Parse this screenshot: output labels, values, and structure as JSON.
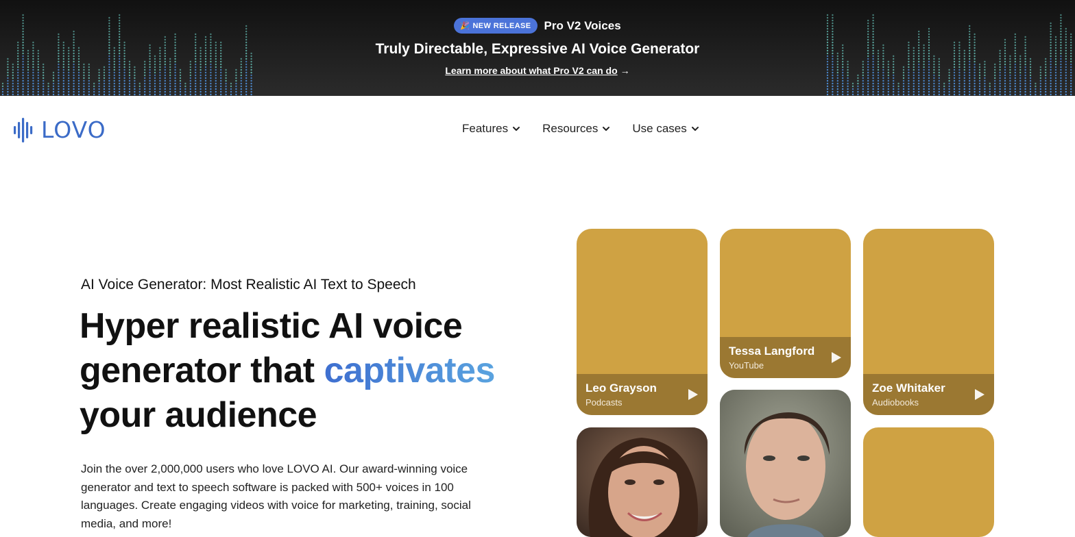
{
  "banner": {
    "badge_label": "NEW RELEASE",
    "badge_icon": "party-popper-icon",
    "product": "Pro V2 Voices",
    "headline": "Truly Directable, Expressive AI Voice Generator",
    "link_text": "Learn more about what Pro V2 can do",
    "link_arrow": "→"
  },
  "nav": {
    "logo_text": "LOVO",
    "menu": [
      {
        "label": "Features"
      },
      {
        "label": "Resources"
      },
      {
        "label": "Use cases"
      }
    ]
  },
  "hero": {
    "eyebrow": "AI Voice Generator: Most Realistic AI Text to Speech",
    "title_part1": "Hyper realistic AI voice generator that ",
    "title_accent": "captivates",
    "title_part2": " your audience",
    "description": "Join the over 2,000,000 users who love LOVO AI. Our award-winning voice generator and text to speech software is packed with 500+ voices in 100 languages. Create engaging videos with voice for marketing, training, social media, and more!"
  },
  "voices": [
    {
      "name": "Leo Grayson",
      "category": "Podcasts"
    },
    {
      "name": "Tessa Langford",
      "category": "YouTube"
    },
    {
      "name": "Zoe Whitaker",
      "category": "Audiobooks"
    }
  ],
  "colors": {
    "brand_blue": "#3b6bc7",
    "badge_blue": "#4b73d9",
    "card_gold": "#cfa243",
    "banner_dark": "#1c1c1c"
  }
}
